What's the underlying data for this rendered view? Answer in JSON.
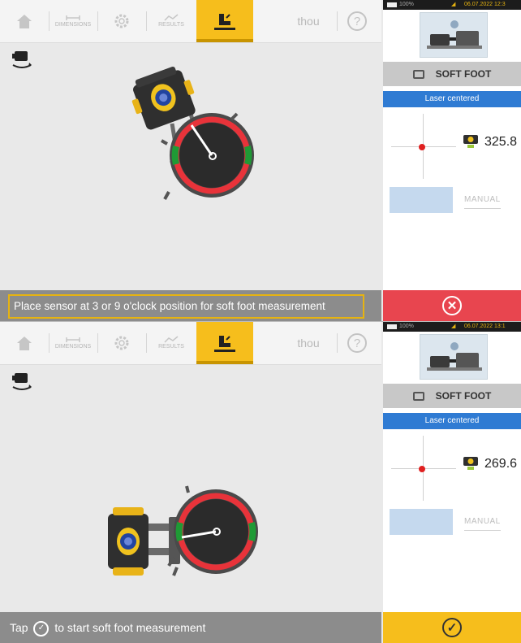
{
  "panels": [
    {
      "toolbar": {
        "dimensions_label": "DIMENSIONS",
        "results_label": "RESULTS",
        "unit_label": "thou",
        "help_label": "?"
      },
      "status_bar": {
        "battery": "100%",
        "datetime": "06.07.2022 12:3"
      },
      "side_panel": {
        "soft_foot_label": "SOFT FOOT",
        "laser_status": "Laser centered",
        "reading": "325.8",
        "disabled_button_label": "",
        "manual_label": "MANUAL",
        "action_icon": "cancel-icon"
      },
      "message": "Place sensor at 3 or 9 o'clock position for soft foot measurement"
    },
    {
      "toolbar": {
        "dimensions_label": "DIMENSIONS",
        "results_label": "RESULTS",
        "unit_label": "thou",
        "help_label": "?"
      },
      "status_bar": {
        "battery": "100%",
        "datetime": "06.07.2022 13:1"
      },
      "side_panel": {
        "soft_foot_label": "SOFT FOOT",
        "laser_status": "Laser centered",
        "reading": "269.6",
        "disabled_button_label": "",
        "manual_label": "MANUAL",
        "action_icon": "confirm-check-icon"
      },
      "message_prefix": "Tap",
      "message_suffix": "to start soft foot measurement"
    }
  ],
  "colors": {
    "accent_yellow": "#f6be1c",
    "laser_blue": "#2f7bd3",
    "cancel_red": "#e8454f",
    "ring_red": "#e8333a",
    "ring_green": "#1f9a35"
  }
}
